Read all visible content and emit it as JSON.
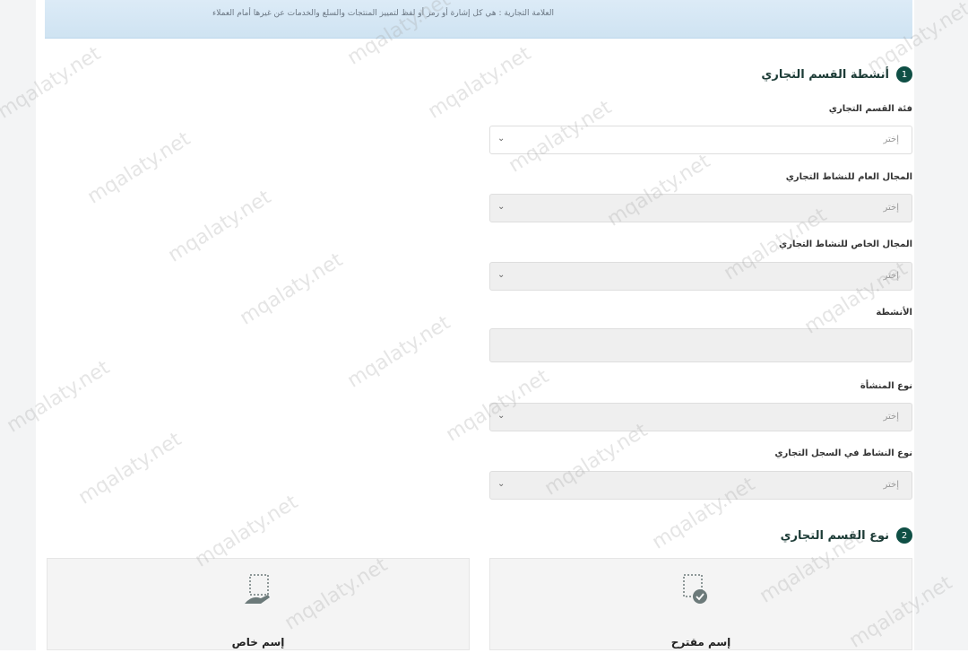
{
  "banner": {
    "text": "العلامة التجارية : هي كل إشارة أو رمز أو لفظ لتمييز المنتجات والسلع والخدمات عن غيرها أمام العملاء"
  },
  "section1": {
    "number": "1",
    "title": "أنشطة القسم التجاري",
    "fields": [
      {
        "label": "فئة القسم التجاري",
        "placeholder": "إختر"
      },
      {
        "label": "المجال العام للنشاط التجاري",
        "placeholder": "إختر"
      },
      {
        "label": "المجال الخاص للنشاط التجاري",
        "placeholder": "إختر"
      },
      {
        "label": "الأنشطة",
        "placeholder": ""
      },
      {
        "label": "نوع المنشأة",
        "placeholder": "إختر"
      },
      {
        "label": "نوع النشاط في السجل التجاري",
        "placeholder": "إختر"
      }
    ]
  },
  "section2": {
    "number": "2",
    "title": "نوع القسم التجاري",
    "options": [
      {
        "label": "إسم مقترح",
        "icon": "suggested-name-icon"
      },
      {
        "label": "إسم خاص",
        "icon": "custom-name-icon"
      }
    ]
  },
  "watermark": "mqalaty.net",
  "colors": {
    "accent": "#0f4f45",
    "banner": "#d6e8f5",
    "field_bg": "#efefef"
  }
}
